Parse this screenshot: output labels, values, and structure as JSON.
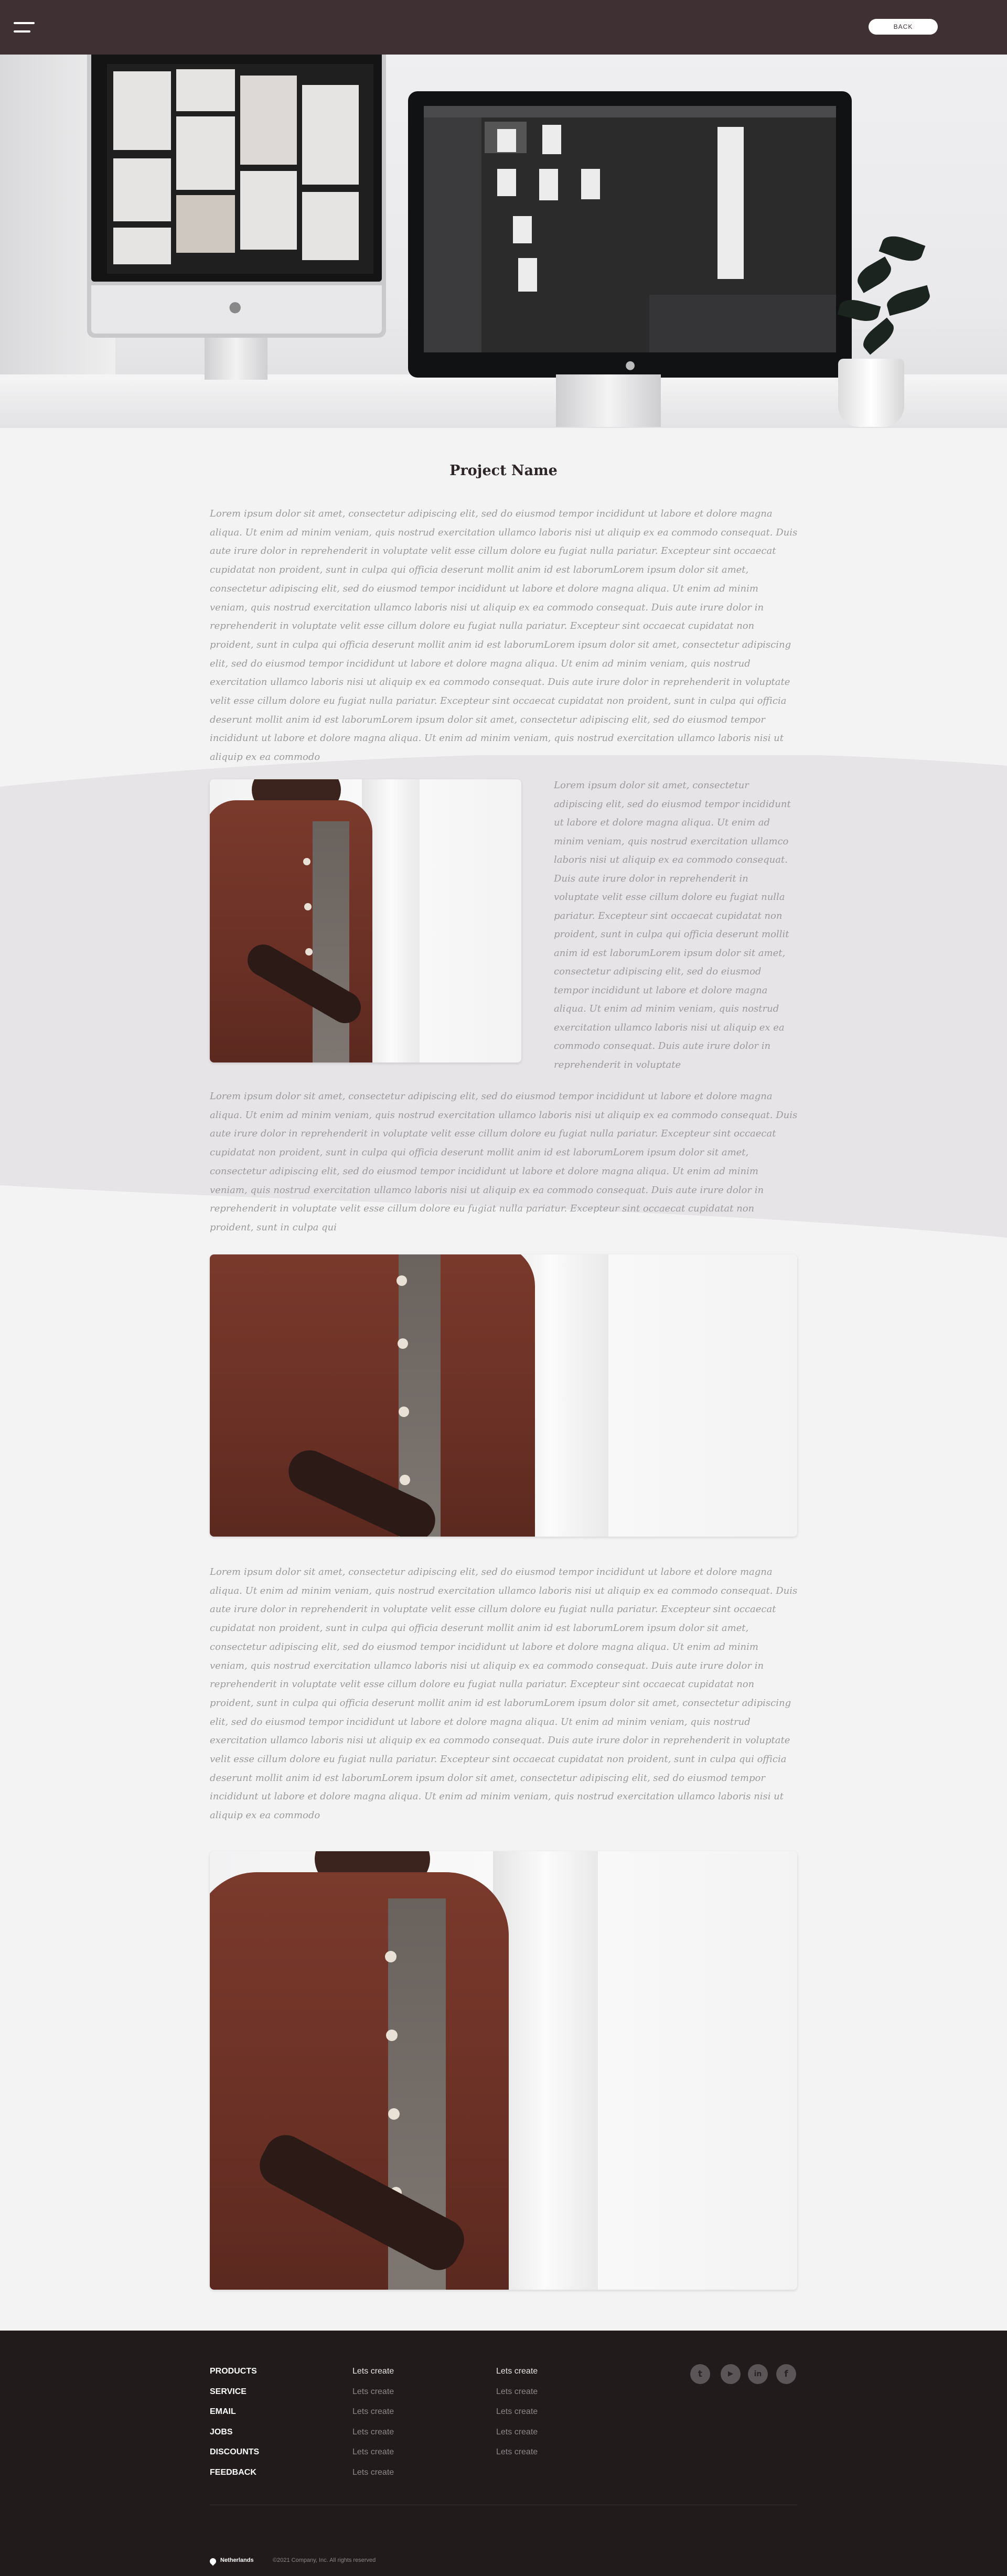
{
  "header": {
    "back_label": "BACK"
  },
  "project": {
    "title": "Project Name",
    "intro": "Lorem ipsum dolor sit amet, consectetur adipiscing elit, sed do eiusmod tempor incididunt ut labore et dolore magna aliqua. Ut enim ad minim veniam, quis nostrud exercitation ullamco laboris nisi ut aliquip ex ea commodo consequat. Duis aute irure dolor in reprehenderit in voluptate velit esse cillum dolore eu fugiat nulla pariatur. Excepteur sint occaecat cupidatat non proident, sunt in culpa qui officia deserunt mollit anim id est laborumLorem ipsum dolor sit amet, consectetur adipiscing elit, sed do eiusmod tempor incididunt ut labore et dolore magna aliqua. Ut enim ad minim veniam, quis nostrud exercitation ullamco laboris nisi ut aliquip ex ea commodo consequat. Duis aute irure dolor in reprehenderit in voluptate velit esse cillum dolore eu fugiat nulla pariatur. Excepteur sint occaecat cupidatat non proident, sunt in culpa qui officia deserunt mollit anim id est laborumLorem ipsum dolor sit amet, consectetur adipiscing elit, sed do eiusmod tempor incididunt ut labore et dolore magna aliqua. Ut enim ad minim veniam, quis nostrud exercitation ullamco laboris nisi ut aliquip ex ea commodo consequat. Duis aute irure dolor in reprehenderit in voluptate velit esse cillum dolore eu fugiat nulla pariatur. Excepteur sint occaecat cupidatat non proident, sunt in culpa qui officia deserunt mollit anim id est laborumLorem ipsum dolor sit amet, consectetur adipiscing elit, sed do eiusmod tempor incididunt ut labore et dolore magna aliqua. Ut enim ad minim veniam, quis nostrud exercitation ullamco laboris nisi ut aliquip ex ea commodo",
    "side_text": "Lorem ipsum dolor sit amet, consectetur adipiscing elit, sed do eiusmod tempor incididunt ut labore et dolore magna aliqua. Ut enim ad minim veniam, quis nostrud exercitation ullamco laboris nisi ut aliquip ex ea commodo consequat. Duis aute irure dolor in reprehenderit in voluptate velit esse cillum dolore eu fugiat nulla pariatur. Excepteur sint occaecat cupidatat non proident, sunt in culpa qui officia deserunt mollit anim id est laborumLorem ipsum dolor sit amet, consectetur adipiscing elit, sed do eiusmod tempor incididunt ut labore et dolore magna aliqua. Ut enim ad minim veniam, quis nostrud exercitation ullamco laboris nisi ut aliquip ex ea commodo consequat. Duis aute irure dolor in reprehenderit in voluptate",
    "band_text": "Lorem ipsum dolor sit amet, consectetur adipiscing elit, sed do eiusmod tempor incididunt ut labore et dolore magna aliqua. Ut enim ad minim veniam, quis nostrud exercitation ullamco laboris nisi ut aliquip ex ea commodo consequat. Duis aute irure dolor in reprehenderit in voluptate velit esse cillum dolore eu fugiat nulla pariatur. Excepteur sint occaecat cupidatat non proident, sunt in culpa qui officia deserunt mollit anim id est laborumLorem ipsum dolor sit amet, consectetur adipiscing elit, sed do eiusmod tempor incididunt ut labore et dolore magna aliqua. Ut enim ad minim veniam, quis nostrud exercitation ullamco laboris nisi ut aliquip ex ea commodo consequat. Duis aute irure dolor in reprehenderit in voluptate velit esse cillum dolore eu fugiat nulla pariatur. Excepteur sint occaecat cupidatat non proident, sunt in culpa qui",
    "body_text": "Lorem ipsum dolor sit amet, consectetur adipiscing elit, sed do eiusmod tempor incididunt ut labore et dolore magna aliqua. Ut enim ad minim veniam, quis nostrud exercitation ullamco laboris nisi ut aliquip ex ea commodo consequat. Duis aute irure dolor in reprehenderit in voluptate velit esse cillum dolore eu fugiat nulla pariatur. Excepteur sint occaecat cupidatat non proident, sunt in culpa qui officia deserunt mollit anim id est laborumLorem ipsum dolor sit amet, consectetur adipiscing elit, sed do eiusmod tempor incididunt ut labore et dolore magna aliqua. Ut enim ad minim veniam, quis nostrud exercitation ullamco laboris nisi ut aliquip ex ea commodo consequat. Duis aute irure dolor in reprehenderit in voluptate velit esse cillum dolore eu fugiat nulla pariatur. Excepteur sint occaecat cupidatat non proident, sunt in culpa qui officia deserunt mollit anim id est laborumLorem ipsum dolor sit amet, consectetur adipiscing elit, sed do eiusmod tempor incididunt ut labore et dolore magna aliqua. Ut enim ad minim veniam, quis nostrud exercitation ullamco laboris nisi ut aliquip ex ea commodo consequat. Duis aute irure dolor in reprehenderit in voluptate velit esse cillum dolore eu fugiat nulla pariatur. Excepteur sint occaecat cupidatat non proident, sunt in culpa qui officia deserunt mollit anim id est laborumLorem ipsum dolor sit amet, consectetur adipiscing elit, sed do eiusmod tempor incididunt ut labore et dolore magna aliqua. Ut enim ad minim veniam, quis nostrud exercitation ullamco laboris nisi ut aliquip ex ea commodo"
  },
  "footer": {
    "col1": [
      "PRODUCTS",
      "SERVICE",
      "EMAIL",
      "JOBS",
      "DISCOUNTS",
      "FEEDBACK"
    ],
    "col2": [
      "Lets create",
      "Lets create",
      "Lets create",
      "Lets create",
      "Lets create",
      "Lets create"
    ],
    "col3": [
      "Lets create",
      "Lets create",
      "Lets create",
      "Lets create",
      "Lets create"
    ],
    "social_icons": [
      "twitter-icon",
      "youtube-icon",
      "linkedin-icon",
      "facebook-icon"
    ],
    "location": "Netherlands",
    "copyright": "©2021 Company, Inc. All rights reserved"
  },
  "colors": {
    "header_bg": "#3f3034",
    "footer_bg": "#211b1c",
    "page_bg": "#f4f3f4",
    "band_bg": "#e6e4e6",
    "body_text": "#9a9a9c",
    "accent_shirt": "#6a3025"
  }
}
